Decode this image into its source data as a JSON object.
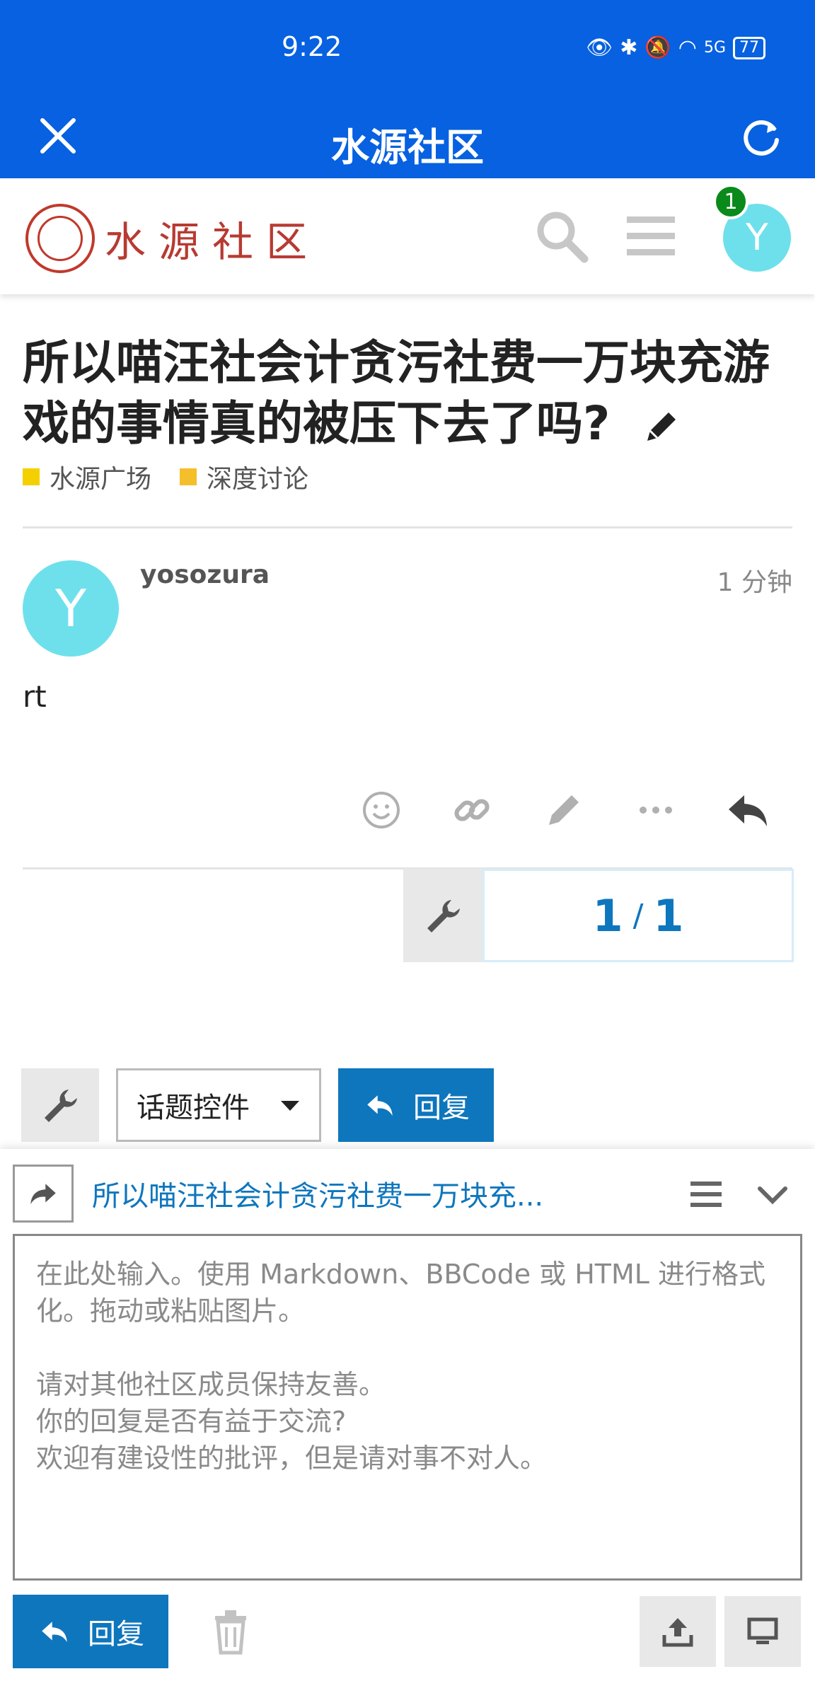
{
  "status_bar": {
    "time": "9:22",
    "battery": "77",
    "network": "5G"
  },
  "app_bar": {
    "title": "水源社区"
  },
  "site_header": {
    "logo_text": "水源社区",
    "notification_count": "1",
    "avatar_letter": "Y"
  },
  "topic": {
    "title": "所以喵汪社会计贪污社费一万块充游戏的事情真的被压下去了吗?",
    "categories": [
      {
        "name": "水源广场",
        "color": "#f5d000"
      },
      {
        "name": "深度讨论",
        "color": "#f4bf2a"
      }
    ]
  },
  "post": {
    "avatar_letter": "Y",
    "username": "yosozura",
    "time_ago": "1 分钟",
    "body": "rt"
  },
  "progress": {
    "current": "1",
    "total": "1"
  },
  "footer": {
    "topic_controls_label": "话题控件",
    "reply_label": "回复"
  },
  "composer": {
    "reply_to_title": "所以喵汪社会计贪污社费一万块充...",
    "placeholder": "在此处输入。使用 Markdown、BBCode 或 HTML 进行格式化。拖动或粘贴图片。\n\n请对其他社区成员保持友善。\n你的回复是否有益于交流?\n欢迎有建设性的批评，但是请对事不对人。",
    "reply_label": "回复"
  },
  "colors": {
    "brand_blue": "#0761e1",
    "accent": "#0e76bd",
    "avatar": "#6ee0ec"
  }
}
